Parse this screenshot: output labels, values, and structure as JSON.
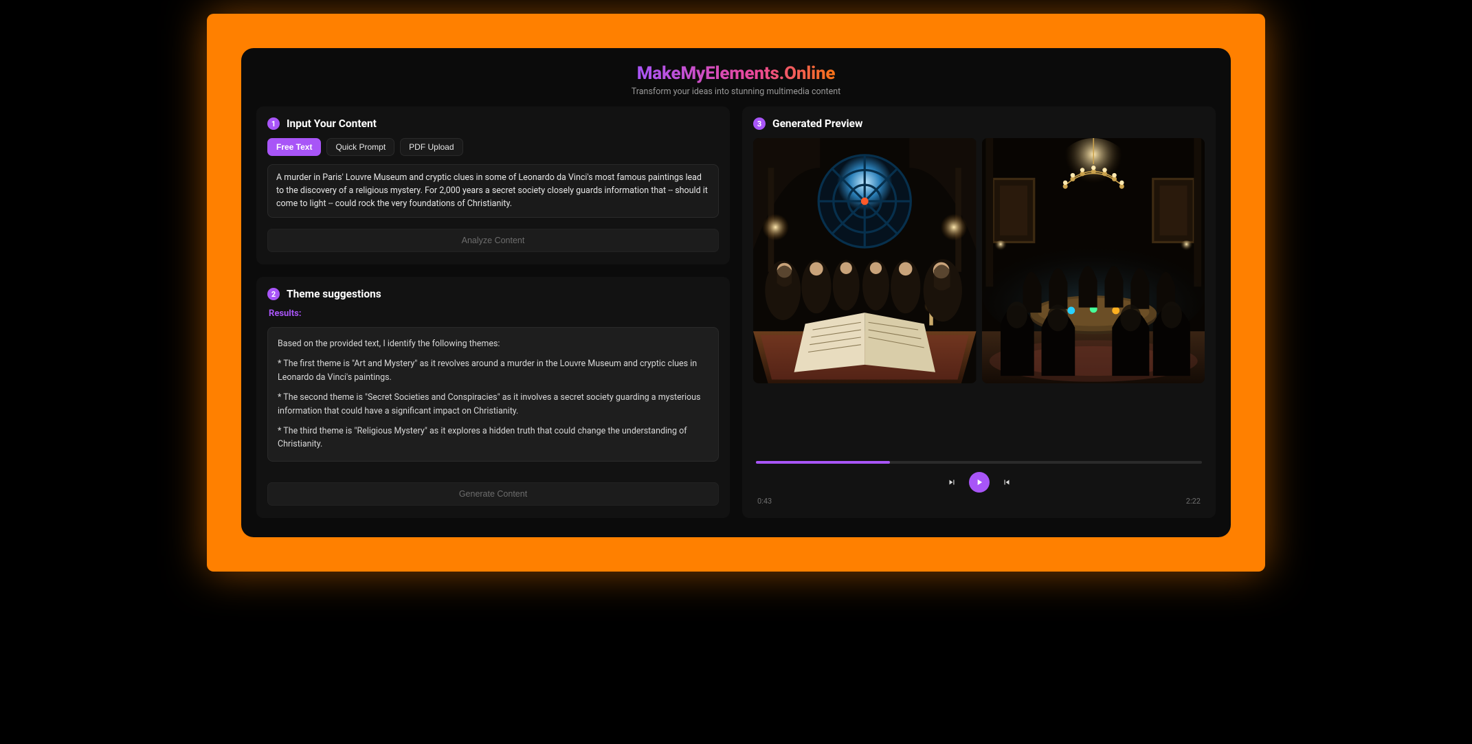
{
  "header": {
    "title": "MakeMyElements.Online",
    "subtitle": "Transform your ideas into stunning multimedia content"
  },
  "input_panel": {
    "badge": "1",
    "title": "Input Your Content",
    "tabs": {
      "free_text": "Free Text",
      "quick_prompt": "Quick Prompt",
      "pdf_upload": "PDF Upload"
    },
    "textarea_value": "A murder in Paris' Louvre Museum and cryptic clues in some of Leonardo da Vinci's most famous paintings lead to the discovery of a religious mystery. For 2,000 years a secret society closely guards information that -- should it come to light -- could rock the very foundations of Christianity.",
    "analyze_button": "Analyze Content"
  },
  "themes_panel": {
    "badge": "2",
    "title": "Theme suggestions",
    "results_label": "Results:",
    "results_intro": "Based on the provided text, I identify the following themes:",
    "theme1": "* The first theme is \"Art and Mystery\" as it revolves around a murder in the Louvre Museum and cryptic clues in Leonardo da Vinci's paintings.",
    "theme2": "* The second theme is \"Secret Societies and Conspiracies\" as it involves a secret society guarding a mysterious information that could have a significant impact on Christianity.",
    "theme3": "* The third theme is \"Religious Mystery\" as it explores a hidden truth that could change the understanding of Christianity.",
    "generate_button": "Generate Content"
  },
  "preview_panel": {
    "badge": "3",
    "title": "Generated Preview",
    "player": {
      "elapsed": "0:43",
      "total": "2:22",
      "progress_percent": 30
    }
  }
}
